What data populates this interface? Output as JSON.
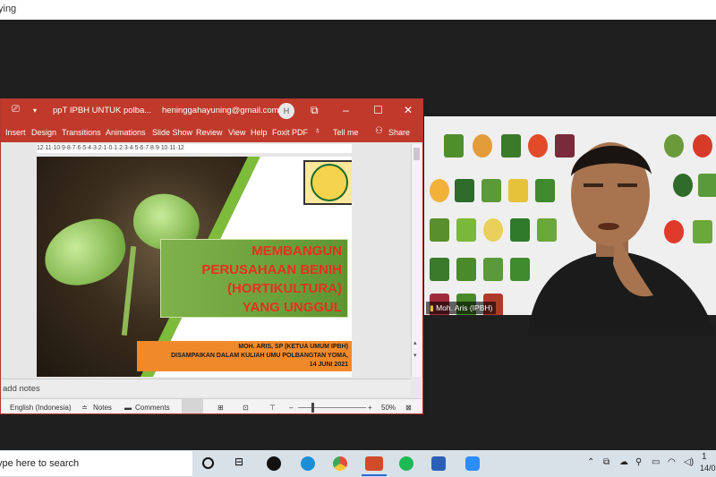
{
  "browser": {
    "partial_title": "ying"
  },
  "ppt": {
    "title": "ppT IPBH UNTUK polba...",
    "account": "heninggahayuning@gmail.com",
    "avatar_initial": "H",
    "ribbon_tabs": [
      "Insert",
      "Design",
      "Transitions",
      "Animations",
      "Slide Show",
      "Review",
      "View",
      "Help",
      "Foxit PDF",
      "Tell me",
      "Share"
    ],
    "ruler": "12·11·10·9·8·7·6·5·4·3·2·1·0·1·2·3·4·5·6·7·8·9·10·11·12",
    "notes_placeholder": "add notes",
    "status": {
      "language": "English (Indonesia)",
      "notes": "Notes",
      "comments": "Comments",
      "zoom": "50%"
    }
  },
  "slide": {
    "title_lines": [
      "MEMBANGUN",
      "PERUSAHAAN BENIH",
      "(HORTIKULTURA)",
      "YANG UNGGUL"
    ],
    "sub_lines": [
      "MOH. ARIS, SP (KETUA UMUM IPBH)",
      "DISAMPAIKAN DALAM KULIAH UMU POLBANGTAN YOMA,",
      "14 JUNI 2021"
    ],
    "logo_text": "IPBH"
  },
  "video": {
    "participant_name": "Moh. Aris (IPBH)"
  },
  "taskbar": {
    "search_text": "ype here to search",
    "clock_partial": "1",
    "date_partial": "14/0"
  },
  "colors": {
    "ppt_red": "#c0392b",
    "slide_green": "#6fa43c",
    "title_red": "#e8301f",
    "sub_orange": "#f0892a"
  }
}
